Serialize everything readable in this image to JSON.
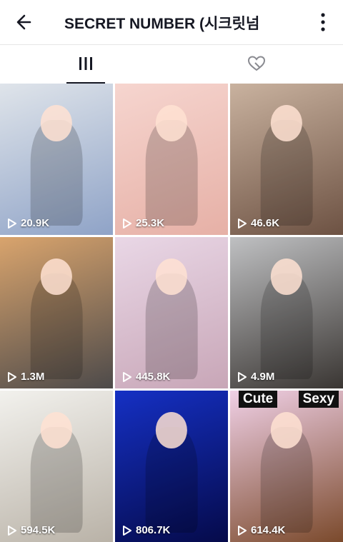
{
  "header": {
    "title": "SECRET NUMBER (시크릿넘"
  },
  "tabs": [
    {
      "icon": "grid-icon",
      "active": true
    },
    {
      "icon": "liked-heart-icon",
      "active": false
    }
  ],
  "videos": [
    {
      "views": "20.9K",
      "bg": [
        "#dfe4ea",
        "#8fa3c7"
      ]
    },
    {
      "views": "25.3K",
      "bg": [
        "#f6d5cf",
        "#e6b0a6"
      ]
    },
    {
      "views": "46.6K",
      "bg": [
        "#c9b29f",
        "#6d5243"
      ]
    },
    {
      "views": "1.3M",
      "bg": [
        "#d9a46d",
        "#4d4a4a"
      ]
    },
    {
      "views": "445.8K",
      "bg": [
        "#e9d7e6",
        "#c8a6b7"
      ]
    },
    {
      "views": "4.9M",
      "bg": [
        "#bfc0c2",
        "#3a3633"
      ]
    },
    {
      "views": "594.5K",
      "bg": [
        "#f2f1ed",
        "#b9b2a7"
      ]
    },
    {
      "views": "806.7K",
      "bg": [
        "#1530c4",
        "#050a4a"
      ]
    },
    {
      "views": "614.4K",
      "bg": [
        "#f0d0e6",
        "#7b4a2c"
      ]
    }
  ],
  "overlays": {
    "cute": "Cute",
    "sexy": "Sexy"
  }
}
